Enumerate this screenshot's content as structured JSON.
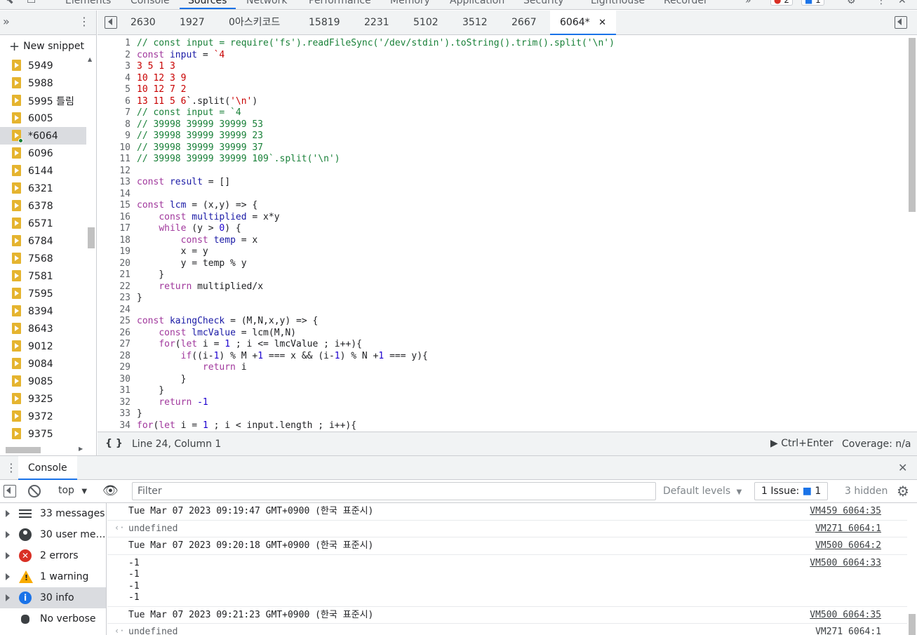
{
  "top_tabs": [
    "Elements",
    "Console",
    "Sources",
    "Network",
    "Performance",
    "Memory",
    "Application",
    "Security",
    "Lighthouse",
    "Recorder"
  ],
  "top_active": "Sources",
  "top_badges": {
    "errors": "2",
    "info": "1"
  },
  "navigator": {
    "new_snippet": "New snippet",
    "snippets": [
      "5949",
      "5988",
      "5995 틀림",
      "6005",
      "*6064",
      "6096",
      "6144",
      "6321",
      "6378",
      "6571",
      "6784",
      "7568",
      "7581",
      "7595",
      "8394",
      "8643",
      "9012",
      "9084",
      "9085",
      "9325",
      "9372",
      "9375"
    ],
    "selected": "*6064"
  },
  "editor_tabs": [
    "2630",
    "1927",
    "0아스키코드",
    "15819",
    "2231",
    "5102",
    "3512",
    "2667",
    "6064*"
  ],
  "code_lines": [
    "// const input = require('fs').readFileSync('/dev/stdin').toString().trim().split('\\n')",
    "const input = `4",
    "3 5 1 3",
    "10 12 3 9",
    "10 12 7 2",
    "13 11 5 6`.split('\\n')",
    "// const input = `4",
    "// 39998 39999 39999 53",
    "// 39998 39999 39999 23",
    "// 39998 39999 39999 37",
    "// 39998 39999 39999 109`.split('\\n')",
    "",
    "const result = []",
    "",
    "const lcm = (x,y) => {",
    "    const multiplied = x*y",
    "    while (y > 0) {",
    "        const temp = x",
    "        x = y",
    "        y = temp % y",
    "    }",
    "    return multiplied/x",
    "}",
    "",
    "const kaingCheck = (M,N,x,y) => {",
    "    const lmcValue = lcm(M,N)",
    "    for(let i = 1 ; i <= lmcValue ; i++){",
    "        if((i-1) % M +1 === x && (i-1) % N +1 === y){",
    "            return i",
    "        }",
    "    }",
    "    return -1",
    "}",
    "for(let i = 1 ; i < input.length ; i++){"
  ],
  "status": {
    "braces": "{ }",
    "position": "Line 24, Column 1",
    "run": "Ctrl+Enter",
    "coverage": "Coverage: n/a"
  },
  "console": {
    "title": "Console",
    "context": "top",
    "filter_placeholder": "Filter",
    "levels": "Default levels",
    "issues_label": "1 Issue:",
    "issues_count": "1",
    "hidden": "3 hidden",
    "sidebar": [
      {
        "label": "33 messages",
        "icon": "list-icon"
      },
      {
        "label": "30 user me…",
        "icon": "user-icon"
      },
      {
        "label": "2 errors",
        "icon": "error-icon"
      },
      {
        "label": "1 warning",
        "icon": "warning-icon"
      },
      {
        "label": "30 info",
        "icon": "info-icon"
      },
      {
        "label": "No verbose",
        "icon": "bug-icon"
      }
    ],
    "messages": [
      {
        "text": "Tue Mar 07 2023 09:19:47 GMT+0900 (한국 표준시)",
        "src": "VM459 6064:35",
        "kind": "log"
      },
      {
        "text": "undefined",
        "src": "VM271 6064:1",
        "kind": "result"
      },
      {
        "text": "Tue Mar 07 2023 09:20:18 GMT+0900 (한국 표준시)",
        "src": "VM500 6064:2",
        "kind": "log"
      },
      {
        "text": "-1\n-1\n-1\n-1",
        "src": "VM500 6064:33",
        "kind": "log"
      },
      {
        "text": "Tue Mar 07 2023 09:21:23 GMT+0900 (한국 표준시)",
        "src": "VM500 6064:35",
        "kind": "log"
      },
      {
        "text": "undefined",
        "src": "VM271 6064:1",
        "kind": "result"
      }
    ]
  }
}
